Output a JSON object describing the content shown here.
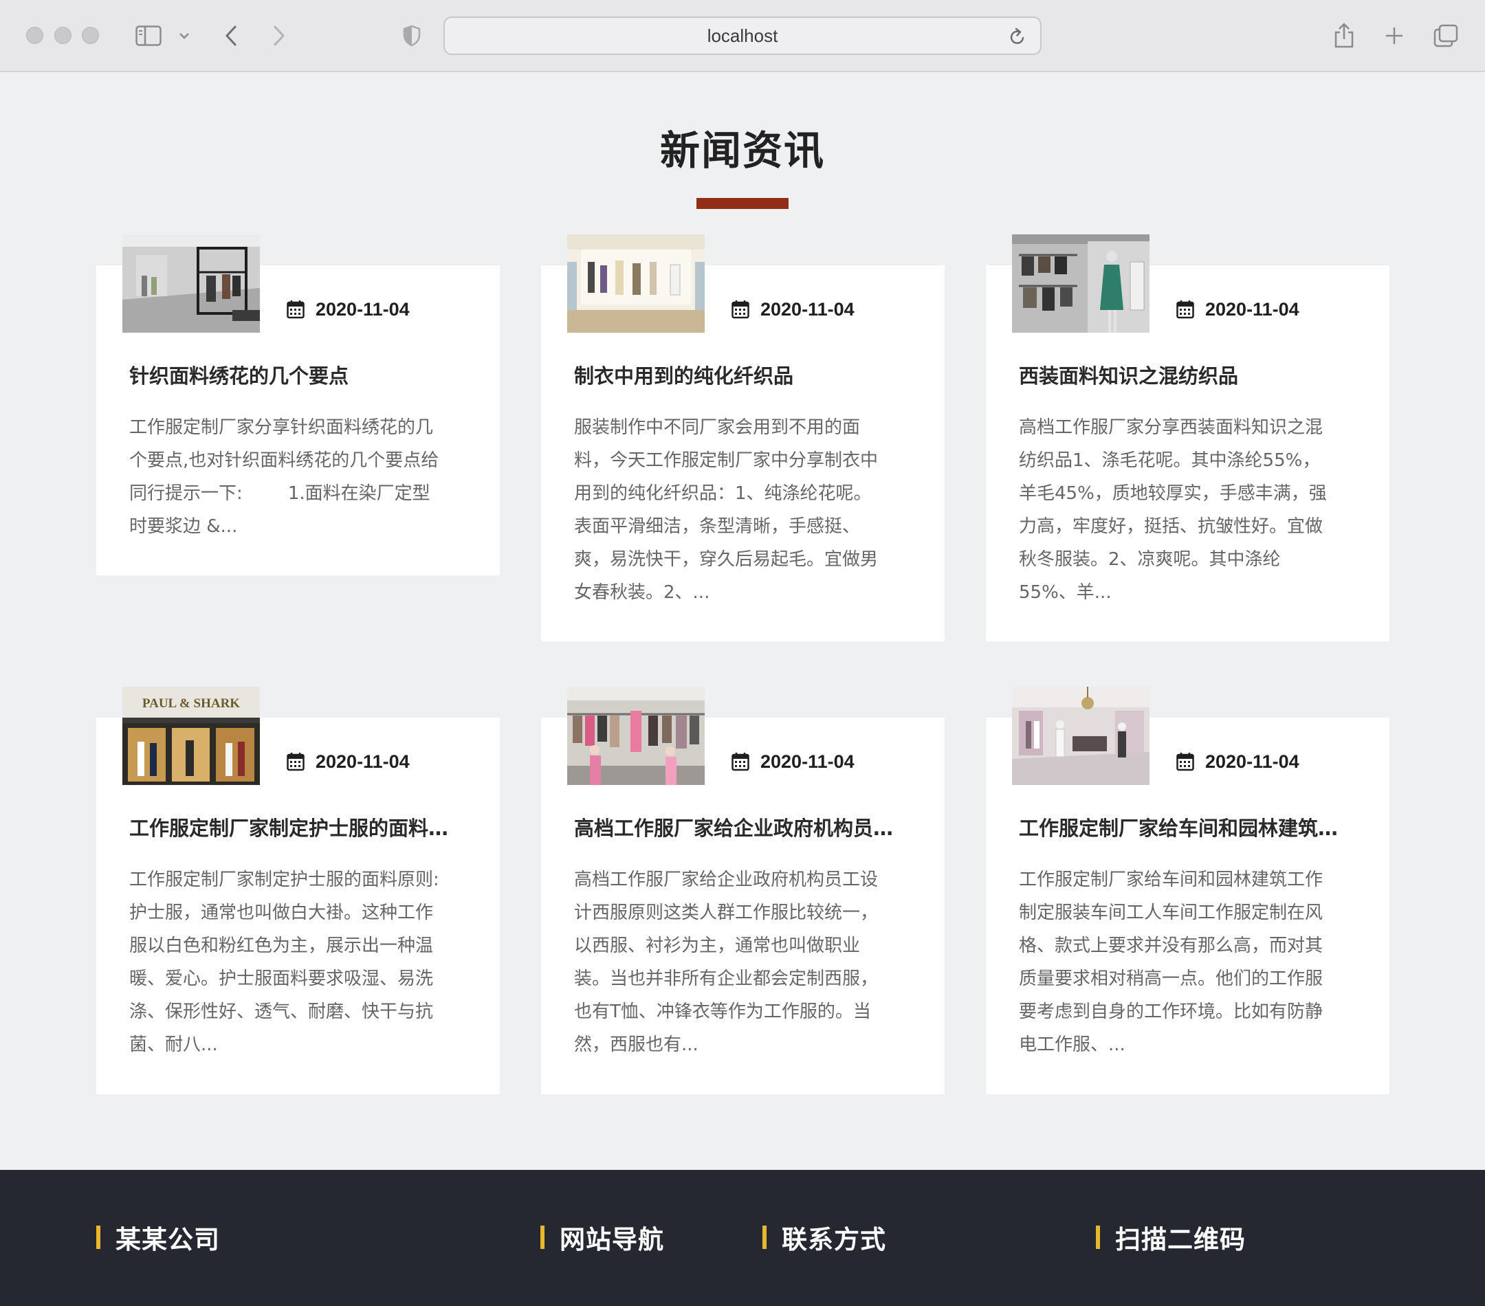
{
  "browser": {
    "url": "localhost"
  },
  "section": {
    "title": "新闻资讯",
    "accent_color": "#922d18"
  },
  "news": [
    {
      "date": "2020-11-04",
      "title": "针织面料绣花的几个要点",
      "lines": [
        "工作服定制厂家分享针织面料绣花的几",
        "个要点,也对针织面料绣花的几个要点给",
        "同行提示一下:        1.面料在染厂定型",
        "时要浆边  &..."
      ],
      "image": "store-interior-gray"
    },
    {
      "date": "2020-11-04",
      "title": "制衣中用到的纯化纤织品",
      "lines": [
        "服装制作中不同厂家会用到不用的面",
        "料，今天工作服定制厂家中分享制衣中",
        "用到的纯化纤织品：1、纯涤纶花呢。",
        "表面平滑细洁，条型清晰，手感挺、",
        "爽，易洗快干，穿久后易起毛。宜做男",
        "女春秋装。2、..."
      ],
      "image": "store-front-bright"
    },
    {
      "date": "2020-11-04",
      "title": "西装面料知识之混纺织品",
      "lines": [
        "高档工作服厂家分享西装面料知识之混",
        "纺织品1、涤毛花呢。其中涤纶55%，",
        "羊毛45%，质地较厚实，手感丰满，强",
        "力高，牢度好，挺括、抗皱性好。宜做",
        "秋冬服装。2、凉爽呢。其中涤纶",
        "55%、羊..."
      ],
      "image": "mannequin-green-dress"
    },
    {
      "date": "2020-11-04",
      "title": "工作服定制厂家制定护士服的面料原则",
      "lines": [
        "工作服定制厂家制定护士服的面料原则:",
        "护士服，通常也叫做白大褂。这种工作",
        "服以白色和粉红色为主，展示出一种温",
        "暖、爱心。护士服面料要求吸湿、易洗",
        "涤、保形性好、透气、耐磨、快干与抗",
        "菌、耐八..."
      ],
      "image": "paul-shark-storefront",
      "sign_text": "PAUL & SHARK"
    },
    {
      "date": "2020-11-04",
      "title": "高档工作服厂家给企业政府机构员工设计西服原则",
      "lines": [
        "高档工作服厂家给企业政府机构员工设",
        "计西服原则这类人群工作服比较统一，",
        "以西服、衬衫为主，通常也叫做职业",
        "装。当也并非所有企业都会定制西服，",
        "也有T恤、冲锋衣等作为工作服的。当",
        "然，西服也有..."
      ],
      "image": "clothing-racks-pink"
    },
    {
      "date": "2020-11-04",
      "title": "工作服定制厂家给车间和园林建筑工作制定服装",
      "lines": [
        "工作服定制厂家给车间和园林建筑工作",
        "制定服装车间工人车间工作服定制在风",
        "格、款式上要求并没有那么高，而对其",
        "质量要求相对稍高一点。他们的工作服",
        "要考虑到自身的工作环境。比如有防静",
        "电工作服、..."
      ],
      "image": "boutique-chandelier"
    }
  ],
  "footer": {
    "columns": [
      "某某公司",
      "网站导航",
      "联系方式",
      "扫描二维码"
    ],
    "accent_color": "#e8b72c"
  }
}
